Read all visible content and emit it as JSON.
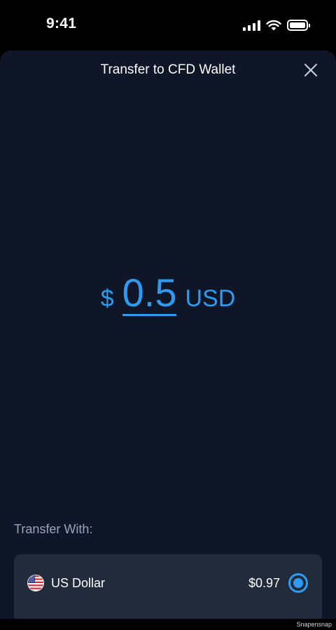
{
  "status_bar": {
    "time": "9:41",
    "icons": [
      "cellular-signal-icon",
      "wifi-icon",
      "battery-icon"
    ]
  },
  "sheet": {
    "title": "Transfer to CFD Wallet",
    "close_icon": "close-icon"
  },
  "amount": {
    "symbol": "$",
    "value": "0.5",
    "currency": "USD"
  },
  "transfer_with": {
    "label": "Transfer With:",
    "options": [
      {
        "flag_icon": "us-flag-icon",
        "name": "US Dollar",
        "balance": "$0.97",
        "selected": true
      }
    ]
  },
  "watermark": "Snapensnap",
  "colors": {
    "background": "#0f1627",
    "card": "#212b3b",
    "accent": "#2f9bf0",
    "muted_text": "#9aa6b8"
  }
}
